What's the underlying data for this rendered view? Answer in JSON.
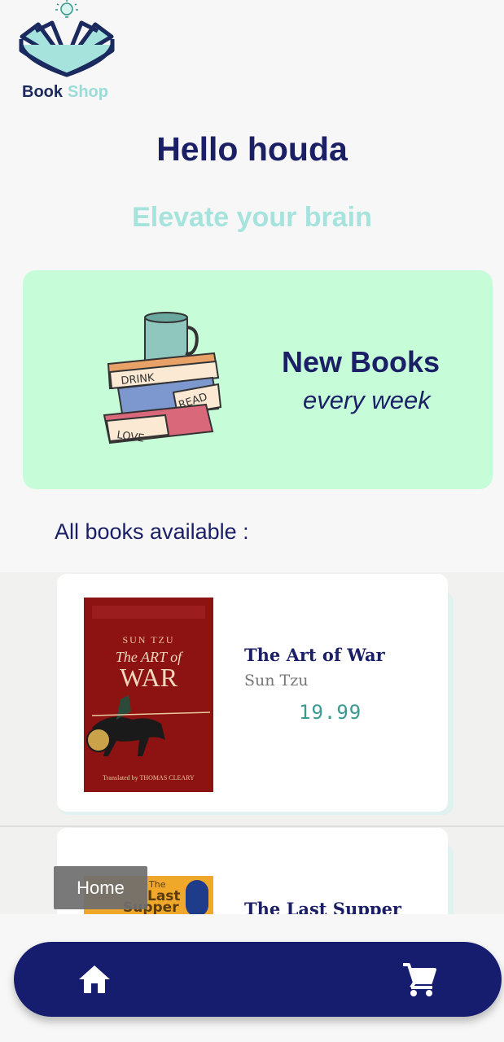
{
  "brand": {
    "name_part1": "Book",
    "name_part2": "Shop"
  },
  "header": {
    "greeting": "Hello houda",
    "tagline": "Elevate your brain"
  },
  "banner": {
    "title": "New Books",
    "subtitle": "every week",
    "illustration_words": [
      "DRINK",
      "READ",
      "LOVE"
    ]
  },
  "section_title": "All books available :",
  "books": [
    {
      "title": "The Art of War",
      "author": "Sun Tzu",
      "price": "19.99",
      "cover": {
        "author": "SUN TZU",
        "title_small": "The ART of",
        "title_big": "WAR",
        "translator": "Translated by THOMAS CLEARY"
      }
    },
    {
      "title": "The Last Supper",
      "cover": {
        "title_line1": "The",
        "title_line2": "Last",
        "title_line3": "Supper"
      }
    }
  ],
  "tooltip": "Home",
  "nav": {
    "home_icon": "home-icon",
    "cart_icon": "cart-icon"
  },
  "colors": {
    "primary": "#161c6e",
    "accent": "#a6e3dc",
    "banner_bg": "#c6fdd8",
    "price": "#3a9a92"
  }
}
